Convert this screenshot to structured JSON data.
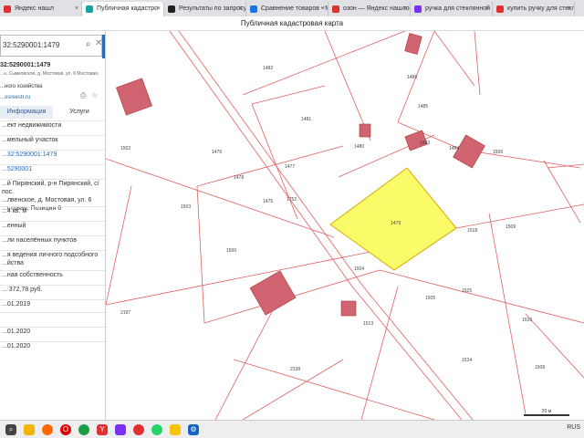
{
  "browser": {
    "tabs": [
      {
        "label": "Яндекс нашл",
        "color": "#e03131",
        "active": false
      },
      {
        "label": "Публичная кадастро",
        "color": "#14a1a8",
        "active": true
      },
      {
        "label": "Результаты по запросу «р",
        "color": "#222222",
        "active": false
      },
      {
        "label": "Сравнение товаров - Ма",
        "color": "#1a73e8",
        "active": false
      },
      {
        "label": "озон — Яндекс нашлось",
        "color": "#e03131",
        "active": false
      },
      {
        "label": "ручка для стеклянной кр",
        "color": "#7b2ff7",
        "active": false
      },
      {
        "label": "купить ручку для стекля",
        "color": "#e03131",
        "active": false
      }
    ]
  },
  "page": {
    "title": "Публичная кадастровая карта"
  },
  "sidebar": {
    "search_value": "32:5290001:1479",
    "parcel_number": "32:5290001:1479",
    "address_snippet": "...н, Сымковское, д. Мостовая, ул. 6 Мостовая,",
    "purpose": "...ного хозяйства",
    "link_snippet": "...osreestr.ru",
    "tabs": [
      "Информация",
      "Услуги"
    ],
    "rows": [
      "...ект недвижимости",
      "...мельный участок",
      "...32:5290001:1479",
      "...5290001",
      "...й Пирянский, р-н Пирянский, с/пос.\n...лвенское, д. Мостовая, ул. 6\n...стовая, Позиция 6",
      "...4 кв. м",
      "...енный",
      "...ли населённых пунктов",
      "...я ведения личного подсобного\n...йства",
      "...ная собственность",
      "... 372,78 руб.",
      "...01.2019",
      "",
      "...01.2020",
      "...01.2020"
    ]
  },
  "map": {
    "highlight_label": "1479",
    "parcel_labels": [
      "1486",
      "1482",
      "1485",
      "1481",
      "1480",
      "1483",
      "1484",
      "1502",
      "1476",
      "1477",
      "1478",
      "1752",
      "1475",
      "1503",
      "1500",
      "1505",
      "1504",
      "1509",
      "1506",
      "1518",
      "2197",
      "1513",
      "1525",
      "1524",
      "2338",
      "1508",
      "1510"
    ],
    "scale_text": "20 м"
  },
  "taskbar": {
    "items": [
      "search",
      "file-explorer",
      "firefox",
      "opera",
      "chrome",
      "yandex",
      "mail",
      "lens",
      "whatsapp",
      "viber",
      "gear"
    ],
    "tray_text": "RUS"
  }
}
